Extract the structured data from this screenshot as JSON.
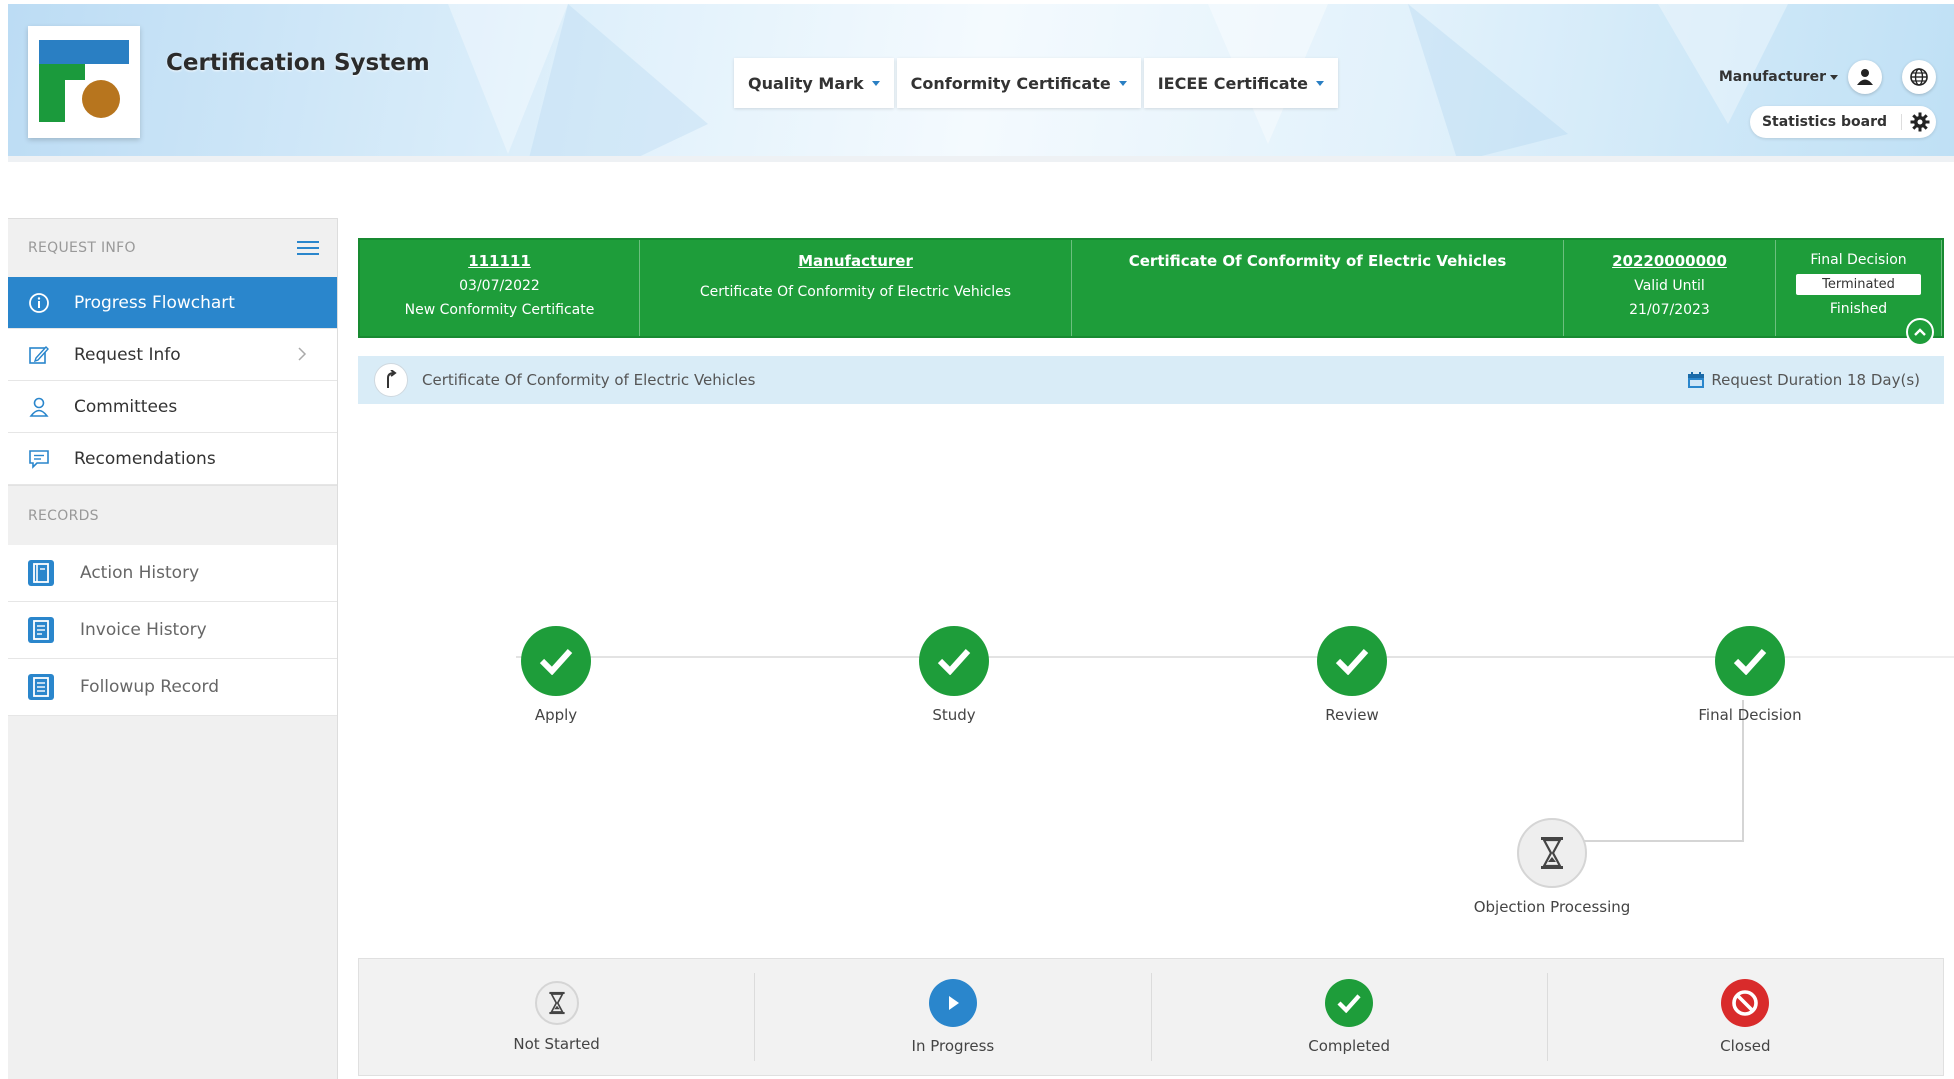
{
  "header": {
    "app_title": "Certification System",
    "nav": [
      {
        "label": "Quality Mark"
      },
      {
        "label": "Conformity Certificate"
      },
      {
        "label": "IECEE Certificate"
      }
    ],
    "user_role": "Manufacturer",
    "statistics_label": "Statistics board"
  },
  "sidebar": {
    "request_section": "REQUEST INFO",
    "records_section": "RECORDS",
    "items": [
      {
        "label": "Progress Flowchart",
        "icon": "info-icon",
        "active": true
      },
      {
        "label": "Request Info",
        "icon": "edit-icon"
      },
      {
        "label": "Committees",
        "icon": "user-icon"
      },
      {
        "label": "Recomendations",
        "icon": "comment-icon"
      }
    ],
    "records": [
      {
        "label": "Action History",
        "icon": "book-icon"
      },
      {
        "label": "Invoice History",
        "icon": "invoice-icon"
      },
      {
        "label": "Followup Record",
        "icon": "record-icon"
      }
    ]
  },
  "info": {
    "request_no": "111111",
    "request_date": "03/07/2022",
    "request_type": "New Conformity Certificate",
    "company": "Manufacturer",
    "company_cert": "Certificate Of Conformity of Electric Vehicles",
    "cert_title": "Certificate Of Conformity of Electric Vehicles",
    "cert_no": "20220000000",
    "valid_label": "Valid Until",
    "valid_date": "21/07/2023",
    "decision_label": "Final Decision",
    "decision_value": "Terminated",
    "decision_status": "Finished"
  },
  "subbar": {
    "title": "Certificate Of Conformity of Electric Vehicles",
    "duration": "Request Duration 18 Day(s)"
  },
  "flow": {
    "steps": [
      "Apply",
      "Study",
      "Review",
      "Final Decision"
    ],
    "branch": "Objection Processing"
  },
  "legend": {
    "not_started": "Not Started",
    "in_progress": "In Progress",
    "completed": "Completed",
    "closed": "Closed"
  },
  "colors": {
    "primary_green": "#1e9d3a",
    "active_blue": "#2a86cc",
    "closed_red": "#d92b2b"
  }
}
